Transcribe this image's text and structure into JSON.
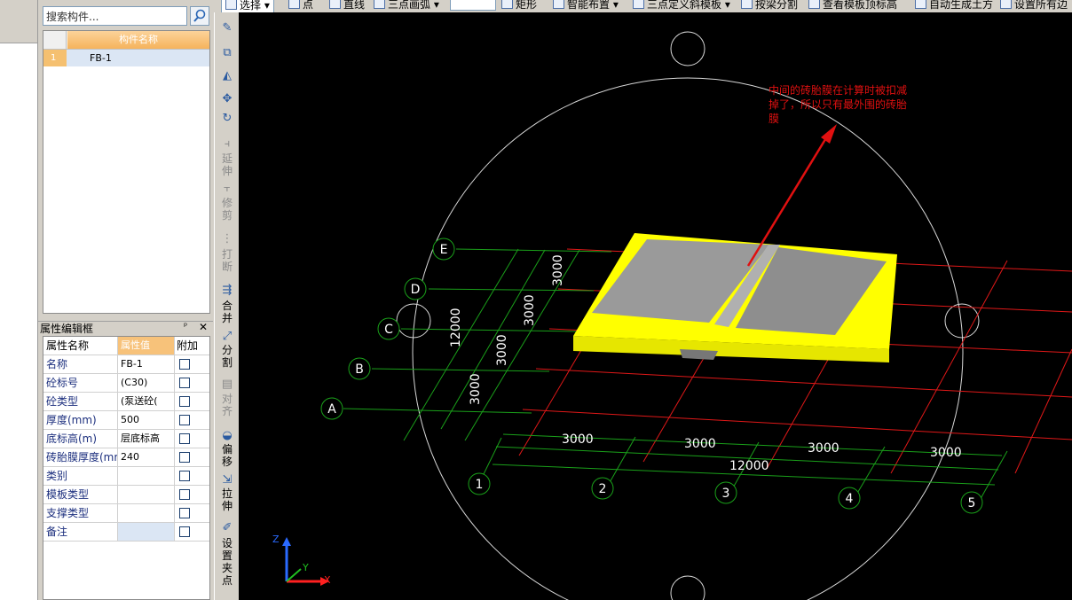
{
  "toolbar": {
    "items": [
      "选择",
      "点",
      "直线",
      "三点画弧",
      "矩形",
      "智能布置",
      "三点定义斜模板",
      "按梁分割",
      "查看模板顶标高",
      "自动生成土方",
      "设置所有边"
    ]
  },
  "component_panel": {
    "search_placeholder": "搜索构件...",
    "column_header": "构件名称",
    "rows": [
      {
        "index": "1",
        "name": "FB-1"
      }
    ]
  },
  "property_panel": {
    "title": "属性编辑框",
    "pin": "ᵖ",
    "close": "✕",
    "headers": {
      "name": "属性名称",
      "value": "属性值",
      "extra": "附加"
    },
    "rows": [
      {
        "name": "名称",
        "value": "FB-1"
      },
      {
        "name": "砼标号",
        "value": "(C30)"
      },
      {
        "name": "砼类型",
        "value": "(泵送砼("
      },
      {
        "name": "厚度(mm)",
        "value": "500"
      },
      {
        "name": "底标高(m)",
        "value": "层底标高"
      },
      {
        "name": "砖胎膜厚度(mm",
        "value": "240"
      },
      {
        "name": "类别",
        "value": ""
      },
      {
        "name": "模板类型",
        "value": ""
      },
      {
        "name": "支撑类型",
        "value": ""
      },
      {
        "name": "备注",
        "value": ""
      }
    ]
  },
  "vertical_tools": {
    "extend": "延伸",
    "trim": "修剪",
    "break": "打断",
    "merge": "合并",
    "split": "分割",
    "align": "对齐",
    "offset": "偏移",
    "stretch": "拉伸",
    "grip": "设置夹点"
  },
  "drawing": {
    "annotation": [
      "中间的砖胎膜在计算时被扣减",
      "掉了，所以只有最外围的砖胎",
      "膜"
    ],
    "axis_letters": [
      "A",
      "B",
      "C",
      "D",
      "E"
    ],
    "axis_numbers": [
      "1",
      "2",
      "3",
      "4",
      "5"
    ],
    "dims_bottom": [
      "3000",
      "3000",
      "3000",
      "3000"
    ],
    "dims_left": [
      "3000",
      "3000",
      "3000",
      "3000"
    ],
    "total_bottom": "12000",
    "total_left": "12000",
    "ucs": {
      "z": "Z",
      "y": "Y",
      "x": "X"
    },
    "colors": {
      "annotation": "#e01010",
      "grid_green": "#1aa01a",
      "grid_red": "#e01818",
      "slab_edge": "#ffff00",
      "slab_top": "#8e8e8e"
    }
  }
}
